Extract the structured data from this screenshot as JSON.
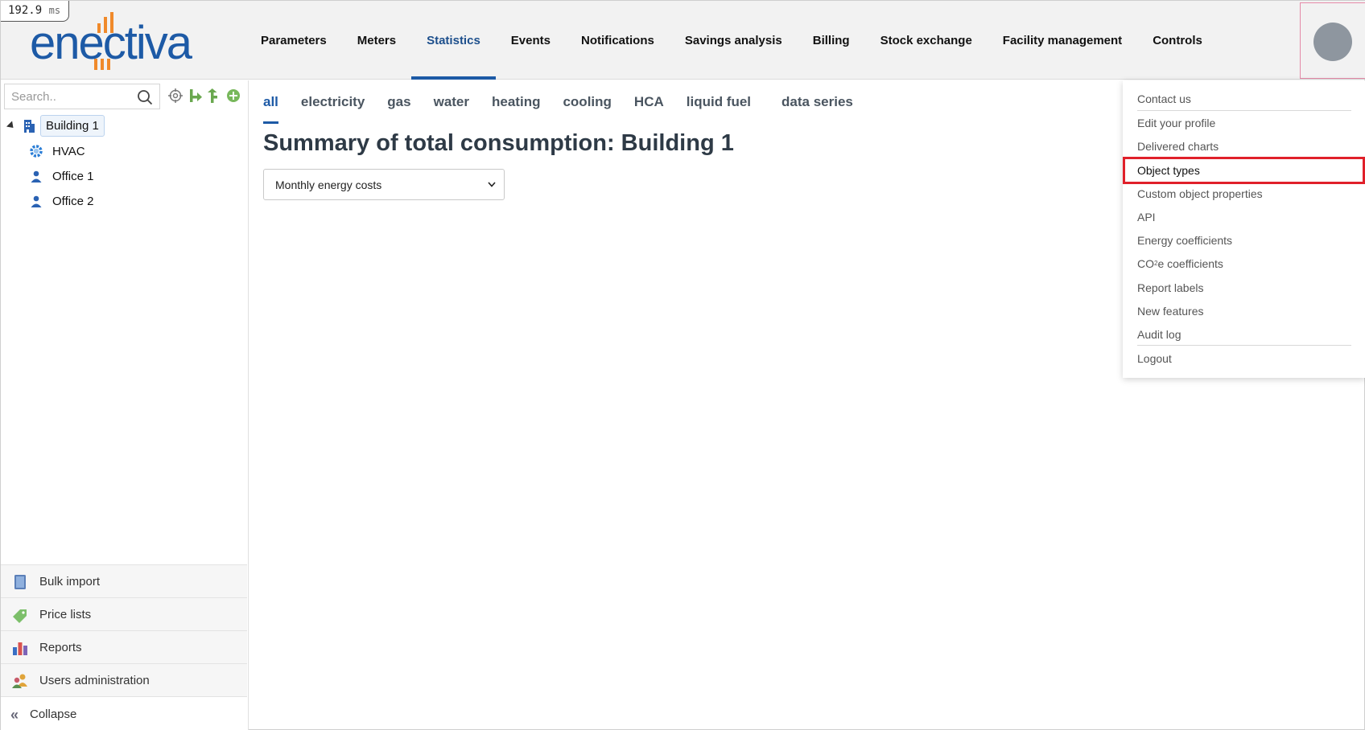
{
  "timer": {
    "value": "192.9",
    "unit": "ms"
  },
  "brand": {
    "logo_text": "enectiva",
    "logo_color": "#1d5aa6",
    "accent_color": "#f08a2b"
  },
  "nav": {
    "items": [
      {
        "label": "Parameters"
      },
      {
        "label": "Meters"
      },
      {
        "label": "Statistics",
        "active": true
      },
      {
        "label": "Events"
      },
      {
        "label": "Notifications"
      },
      {
        "label": "Savings analysis"
      },
      {
        "label": "Billing"
      },
      {
        "label": "Stock exchange"
      },
      {
        "label": "Facility management"
      },
      {
        "label": "Controls"
      }
    ]
  },
  "sidebar": {
    "search": {
      "placeholder": "Search..",
      "value": ""
    },
    "tools": [
      "target-icon",
      "add-branch-icon",
      "move-branch-icon",
      "add-circle-icon"
    ],
    "tree": [
      {
        "label": "Building 1",
        "icon": "building-icon",
        "selected": true,
        "expanded": true
      },
      {
        "label": "HVAC",
        "icon": "gear-icon"
      },
      {
        "label": "Office 1",
        "icon": "person-icon"
      },
      {
        "label": "Office 2",
        "icon": "person-icon"
      }
    ],
    "menu": [
      {
        "label": "Bulk import",
        "icon": "import-icon"
      },
      {
        "label": "Price lists",
        "icon": "price-tag-icon"
      },
      {
        "label": "Reports",
        "icon": "bar-chart-icon"
      },
      {
        "label": "Users administration",
        "icon": "users-icon"
      }
    ],
    "collapse_label": "Collapse"
  },
  "main": {
    "tabs": [
      {
        "label": "all",
        "active": true
      },
      {
        "label": "electricity"
      },
      {
        "label": "gas"
      },
      {
        "label": "water"
      },
      {
        "label": "heating"
      },
      {
        "label": "cooling"
      },
      {
        "label": "HCA"
      },
      {
        "label": "liquid fuel"
      },
      {
        "label": "data series"
      }
    ],
    "title": "Summary of total consumption: Building 1",
    "select": {
      "value": "Monthly energy costs"
    }
  },
  "user_menu": {
    "items": [
      {
        "label": "Contact us"
      },
      {
        "label": "Edit your profile"
      },
      {
        "label": "Delivered charts"
      },
      {
        "label": "Object types",
        "highlighted": true
      },
      {
        "label": "Custom object properties"
      },
      {
        "label": "API"
      },
      {
        "label": "Energy coefficients"
      },
      {
        "label_pre": "CO",
        "label_sub": "2",
        "label_post": "e coefficients"
      },
      {
        "label": "Report labels"
      },
      {
        "label": "New features"
      },
      {
        "label": "Audit log"
      },
      {
        "label": "Logout"
      }
    ],
    "highlight_color": "#e0202a"
  }
}
